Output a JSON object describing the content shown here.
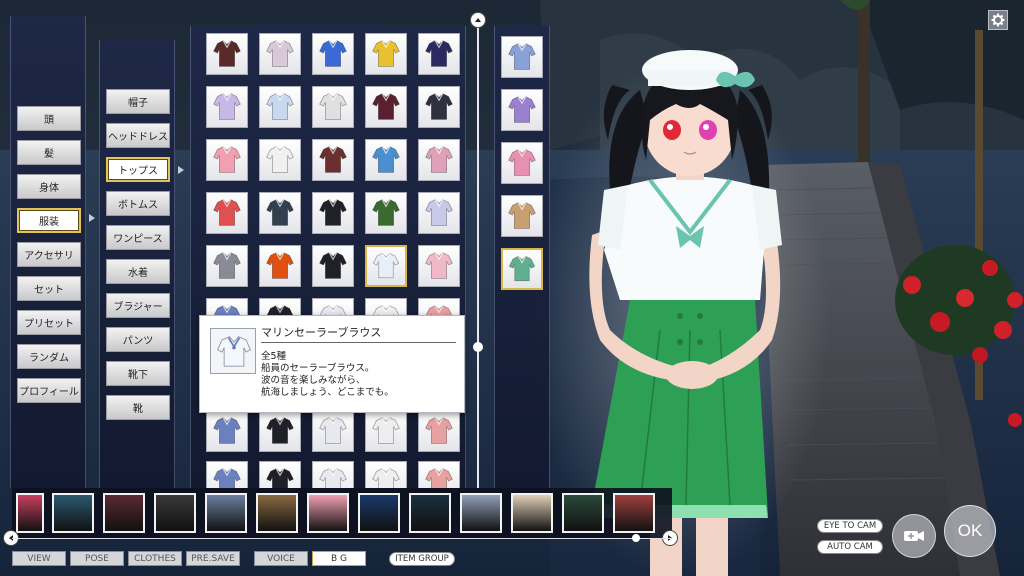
{
  "categories": {
    "items": [
      "頭",
      "髪",
      "身体",
      "服装",
      "アクセサリ",
      "セット",
      "プリセット",
      "ランダム",
      "プロフィール"
    ],
    "selected_index": 3
  },
  "subcategories": {
    "items": [
      "帽子",
      "ヘッドドレス",
      "トップス",
      "ボトムス",
      "ワンピース",
      "水着",
      "ブラジャー",
      "パンツ",
      "靴下",
      "靴"
    ],
    "selected_index": 2
  },
  "item_grid": {
    "tiles": [
      {
        "icon": "dark-coat-icon",
        "color": "#5a2a2a"
      },
      {
        "icon": "hoodie-icon",
        "color": "#d8c8d8"
      },
      {
        "icon": "bandeau-top-icon",
        "color": "#3a6ad8"
      },
      {
        "icon": "tank-top-icon",
        "color": "#e8c030"
      },
      {
        "icon": "sailor-bow-top-icon",
        "color": "#2a2a60"
      },
      {
        "icon": "blouse-icon",
        "color": "#c8b8e8"
      },
      {
        "icon": "sailor-shirt-icon",
        "color": "#c8d8f0"
      },
      {
        "icon": "vest-icon",
        "color": "#e0e0e0"
      },
      {
        "icon": "corset-top-icon",
        "color": "#5a2030"
      },
      {
        "icon": "black-jacket-icon",
        "color": "#303040"
      },
      {
        "icon": "pink-blouse-icon",
        "color": "#f0a0b0"
      },
      {
        "icon": "white-collar-shirt-icon",
        "color": "#f0f0f0"
      },
      {
        "icon": "brown-shirt-icon",
        "color": "#6a3030"
      },
      {
        "icon": "blue-jacket-icon",
        "color": "#4a90d0"
      },
      {
        "icon": "pink-cardigan-icon",
        "color": "#e0a0b8"
      },
      {
        "icon": "red-shirt-icon",
        "color": "#e05050"
      },
      {
        "icon": "navy-blazer-icon",
        "color": "#304050"
      },
      {
        "icon": "black-suit-icon",
        "color": "#202028"
      },
      {
        "icon": "green-jacket-icon",
        "color": "#3a6a30"
      },
      {
        "icon": "lavender-top-icon",
        "color": "#c8c8e8"
      },
      {
        "icon": "armor-top-icon",
        "color": "#8a8a98"
      },
      {
        "icon": "china-top-icon",
        "color": "#e05010"
      },
      {
        "icon": "black-coat-icon",
        "color": "#202028"
      },
      {
        "icon": "marine-sailor-blouse-icon",
        "color": "#e8eef8"
      },
      {
        "icon": "pink-kimono-top-icon",
        "color": "#f0b8c8"
      }
    ],
    "selected_index": 23,
    "lower_tiles": [
      {
        "icon": "sailor-top-icon",
        "color": "#6a80c0"
      },
      {
        "icon": "dark-blazer-icon",
        "color": "#202028"
      },
      {
        "icon": "white-blouse-icon",
        "color": "#e8e8f0"
      },
      {
        "icon": "white-shirt-icon",
        "color": "#eeeeee"
      },
      {
        "icon": "peach-top-icon",
        "color": "#e8a0a0"
      }
    ]
  },
  "variants": {
    "tiles": [
      {
        "icon": "marine-blouse-variant-blue-icon",
        "color": "#8aa0d8"
      },
      {
        "icon": "marine-blouse-variant-purple-icon",
        "color": "#9a80d0"
      },
      {
        "icon": "marine-blouse-variant-pink-icon",
        "color": "#e890b0"
      },
      {
        "icon": "marine-blouse-variant-tan-icon",
        "color": "#c8a070"
      },
      {
        "icon": "marine-blouse-variant-green-icon",
        "color": "#60b090"
      }
    ],
    "selected_index": 4
  },
  "tooltip": {
    "title": "マリンセーラーブラウス",
    "lines": [
      "全5種",
      "船員のセーラーブラウス。",
      "波の音を楽しみながら、",
      "航海しましょう、どこまでも。"
    ]
  },
  "bg_strip": {
    "thumbs": [
      {
        "icon": "bg-pink-room-icon",
        "color": "#c84060"
      },
      {
        "icon": "bg-pool-icon",
        "color": "#2a5a70"
      },
      {
        "icon": "bg-restaurant-icon",
        "color": "#5a2a30"
      },
      {
        "icon": "bg-dark-room-icon",
        "color": "#3a3a3a"
      },
      {
        "icon": "bg-shop-icon",
        "color": "#6a80a0"
      },
      {
        "icon": "bg-classroom-icon",
        "color": "#8a6a40"
      },
      {
        "icon": "bg-cake-room-icon",
        "color": "#f0a0b0"
      },
      {
        "icon": "bg-night-pool-icon",
        "color": "#1a3a6a"
      },
      {
        "icon": "bg-night-beach-icon",
        "color": "#1a3040"
      },
      {
        "icon": "bg-stairs-icon",
        "color": "#90a0b8"
      },
      {
        "icon": "bg-bright-room-icon",
        "color": "#e0d0b8"
      },
      {
        "icon": "bg-green-hall-icon",
        "color": "#2a4a3a"
      },
      {
        "icon": "bg-red-room-icon",
        "color": "#a04040"
      }
    ]
  },
  "bottom_bar": {
    "view": "VIEW",
    "pose": "POSE",
    "clothes": "CLOTHES",
    "pre_save": "PRE.SAVE",
    "voice": "VOICE",
    "bg": "B G",
    "item_group": "ITEM GROUP"
  },
  "camera": {
    "eye_to_cam": "EYE TO CAM",
    "auto_cam": "AUTO CAM",
    "ok": "OK"
  },
  "colors": {
    "selection_border": "#d9b649",
    "panel_bg": "#1e2848",
    "skirt_green": "#2ea055",
    "sailor_ribbon": "#6ac4b0"
  }
}
